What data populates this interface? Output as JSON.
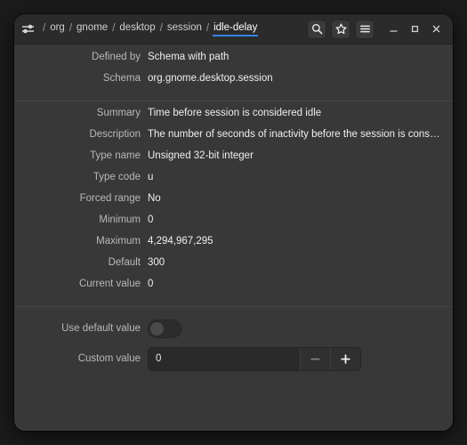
{
  "window": {
    "breadcrumb": {
      "icon": "settings-sliders-icon",
      "separator": "/",
      "items": [
        {
          "label": "org",
          "active": false
        },
        {
          "label": "gnome",
          "active": false
        },
        {
          "label": "desktop",
          "active": false
        },
        {
          "label": "session",
          "active": false
        },
        {
          "label": "idle-delay",
          "active": true
        }
      ]
    },
    "header_buttons": [
      {
        "name": "search-button",
        "icon": "search-icon"
      },
      {
        "name": "bookmark-button",
        "icon": "star-icon"
      },
      {
        "name": "menu-button",
        "icon": "hamburger-menu-icon"
      }
    ],
    "window_controls": [
      {
        "name": "minimize-button",
        "icon": "minimize-icon"
      },
      {
        "name": "maximize-button",
        "icon": "maximize-icon"
      },
      {
        "name": "close-button",
        "icon": "close-icon"
      }
    ]
  },
  "properties_group_1": [
    {
      "label": "Defined by",
      "value": "Schema with path"
    },
    {
      "label": "Schema",
      "value": "org.gnome.desktop.session"
    }
  ],
  "properties_group_2": [
    {
      "label": "Summary",
      "value": "Time before session is considered idle"
    },
    {
      "label": "Description",
      "value": "The number of seconds of inactivity before the session is considered idle."
    },
    {
      "label": "Type name",
      "value": "Unsigned 32-bit integer"
    },
    {
      "label": "Type code",
      "value": "u"
    },
    {
      "label": "Forced range",
      "value": "No"
    },
    {
      "label": "Minimum",
      "value": "0"
    },
    {
      "label": "Maximum",
      "value": "4,294,967,295"
    },
    {
      "label": "Default",
      "value": "300"
    },
    {
      "label": "Current value",
      "value": "0"
    }
  ],
  "controls": {
    "use_default": {
      "label": "Use default value",
      "state": "off"
    },
    "custom_value": {
      "label": "Custom value",
      "value": "0",
      "decrement_label": "−",
      "increment_label": "+",
      "decrement_enabled": false,
      "increment_enabled": true
    }
  },
  "colors": {
    "accent": "#3584e4",
    "header_bg": "#2b2b2b",
    "content_bg": "#383838",
    "text": "#efefef",
    "label_text": "#b9b9b9"
  }
}
